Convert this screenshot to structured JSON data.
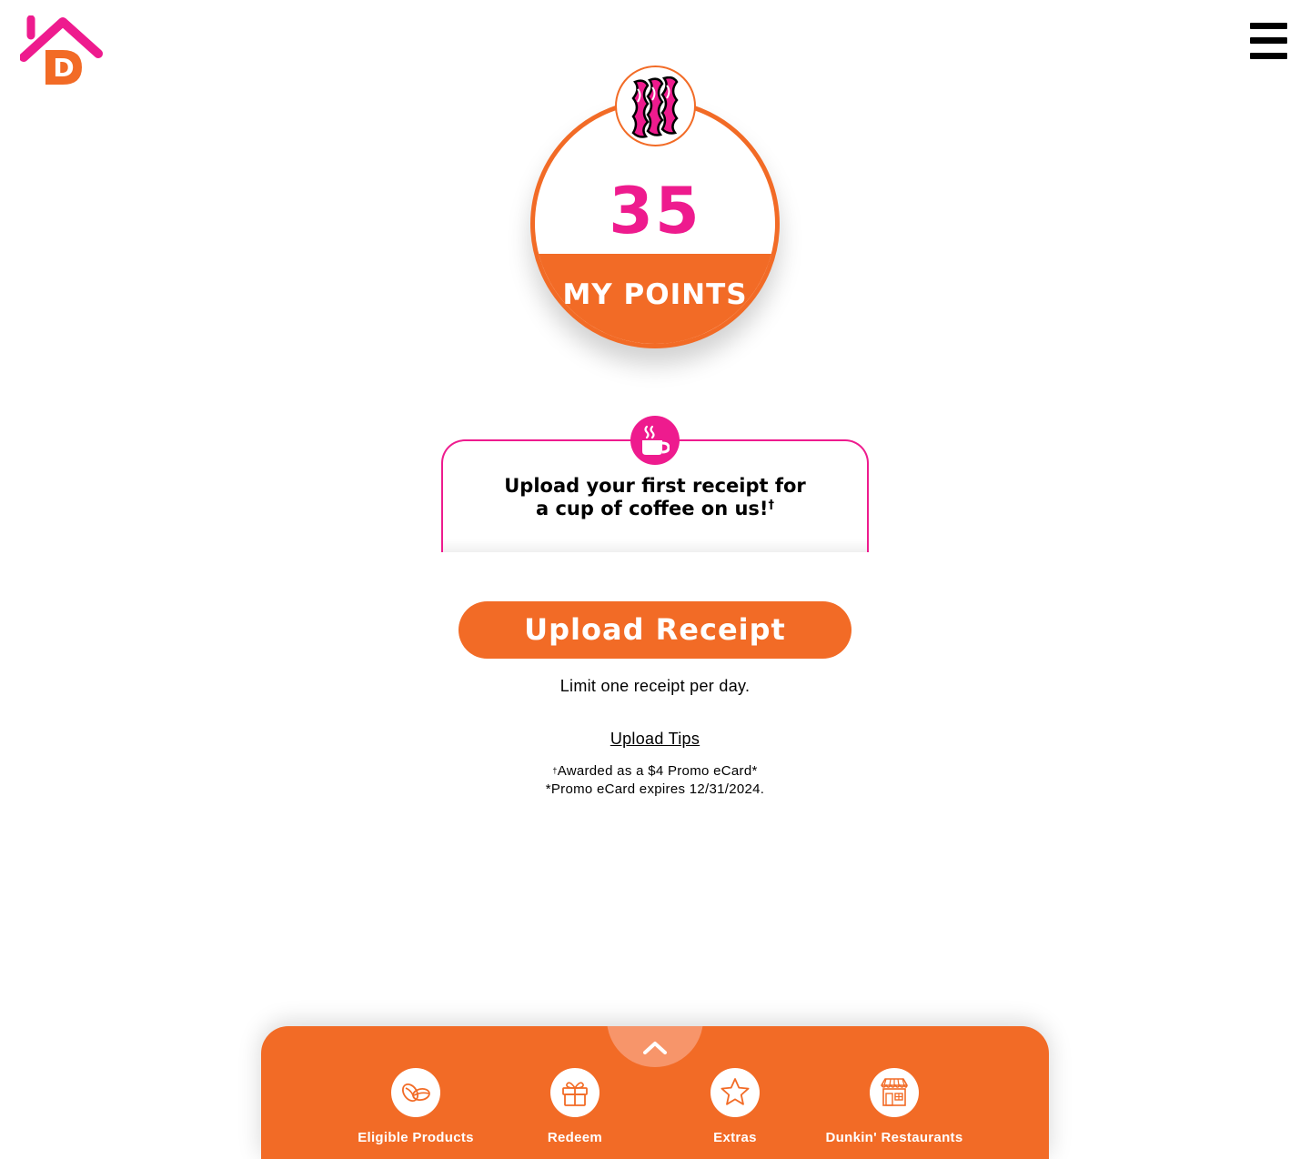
{
  "header": {
    "logo_icon": "dunkin-home-logo",
    "menu_icon": "hamburger-menu-icon"
  },
  "points": {
    "badge_icon": "bacon-icon",
    "value": "35",
    "label": "MY POINTS"
  },
  "promo": {
    "icon": "coffee-cup-icon",
    "line1": "Upload your first receipt for",
    "line2": "a cup of coffee on us!",
    "dagger": "†"
  },
  "upload": {
    "button_label": "Upload Receipt",
    "limit_text": "Limit one receipt per day.",
    "tips_link": "Upload Tips",
    "disclaimer_mark": "†",
    "disclaimer_line1": "Awarded as a $4 Promo eCard*",
    "disclaimer_line2": "*Promo eCard expires 12/31/2024."
  },
  "bottom_nav": {
    "toggle_icon": "chevron-up-icon",
    "items": [
      {
        "label": "Eligible Products",
        "icon": "coffee-beans-icon"
      },
      {
        "label": "Redeem",
        "icon": "gift-icon"
      },
      {
        "label": "Extras",
        "icon": "star-icon"
      },
      {
        "label": "Dunkin' Restaurants",
        "icon": "storefront-icon"
      }
    ]
  },
  "colors": {
    "orange": "#f26b26",
    "pink": "#ee1b8e",
    "light_orange": "#f7956a"
  }
}
